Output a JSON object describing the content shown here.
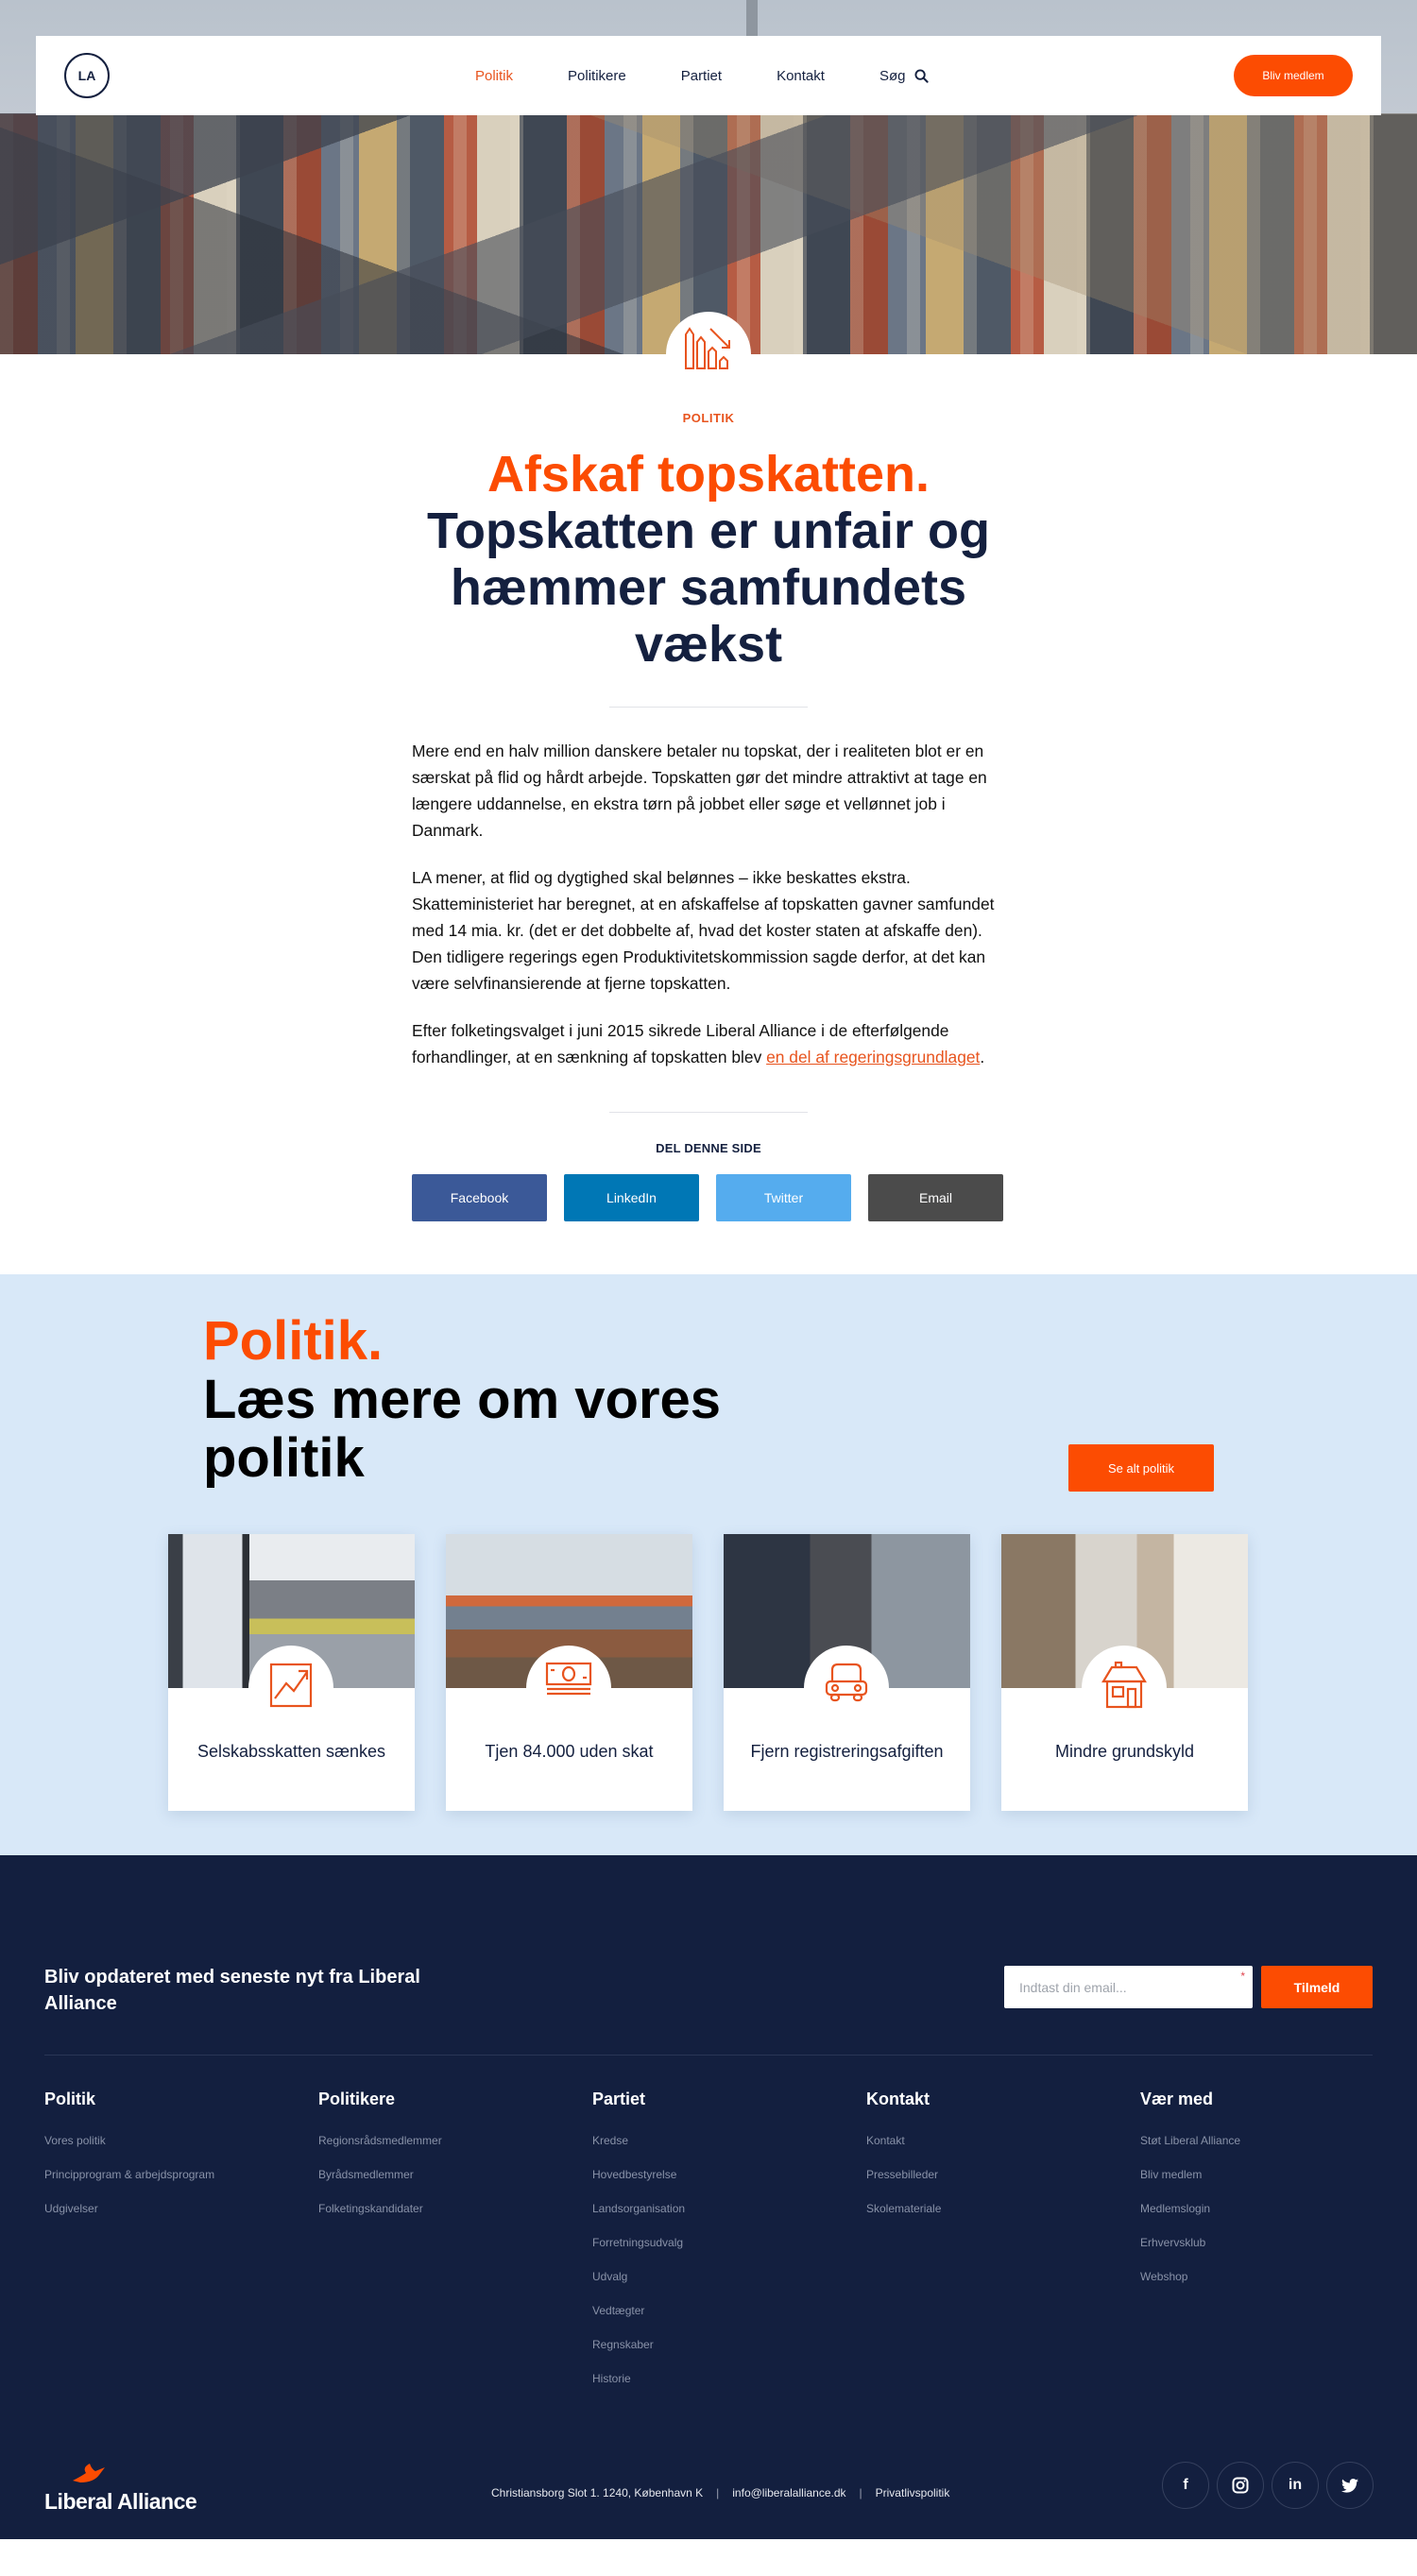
{
  "colors": {
    "accent": "#fc4c02",
    "navy": "#14203f",
    "footer_bg": "#131f3f",
    "section_bg": "#d8e8f8",
    "facebook": "#3b5998",
    "linkedin": "#0077b5",
    "twitter": "#55acee",
    "email": "#4b4b4b"
  },
  "header": {
    "logo_text": "LA",
    "nav": [
      {
        "label": "Politik",
        "active": true
      },
      {
        "label": "Politikere",
        "active": false
      },
      {
        "label": "Partiet",
        "active": false
      },
      {
        "label": "Kontakt",
        "active": false
      }
    ],
    "search_label": "Søg",
    "search_icon": "search-icon",
    "cta_label": "Bliv medlem"
  },
  "hero": {
    "badge_icon": "declining-bar-chart-icon"
  },
  "article": {
    "category": "POLITIK",
    "title_highlight": "Afskaf topskatten.",
    "title_main": "Topskatten er unfair og hæmmer samfundets vækst",
    "paragraphs": [
      "Mere end en halv million danskere betaler nu topskat, der i realiteten blot er en særskat på flid og hårdt arbejde. Topskatten gør det mindre attraktivt at tage en længere uddannelse, en ekstra tørn på jobbet eller søge et vellønnet job i Danmark.",
      "LA mener, at flid og dygtighed skal belønnes – ikke beskattes ekstra. Skatteministeriet har beregnet, at en afskaffelse af topskatten gavner samfundet med 14 mia. kr. (det er det dobbelte af, hvad det koster staten at afskaffe den). Den tidligere regerings egen Produktivitetskommission sagde derfor, at det kan være selvfinansierende at fjerne topskatten."
    ],
    "para3_before": "Efter folketingsvalget i juni 2015 sikrede Liberal Alliance i de efterfølgende forhandlinger, at en sænkning af topskatten blev ",
    "para3_link": "en del af regeringsgrundlaget",
    "para3_after": ".",
    "share": {
      "title": "DEL DENNE SIDE",
      "buttons": [
        "Facebook",
        "LinkedIn",
        "Twitter",
        "Email"
      ]
    }
  },
  "politik_section": {
    "heading_highlight": "Politik.",
    "heading_main": "Læs mere om vores politik",
    "cta_label": "Se alt politik",
    "cards": [
      {
        "title": "Selskabsskatten sænkes",
        "icon": "trending-up-icon"
      },
      {
        "title": "Tjen 84.000 uden skat",
        "icon": "banknote-icon"
      },
      {
        "title": "Fjern registreringsafgiften",
        "icon": "car-icon"
      },
      {
        "title": "Mindre grundskyld",
        "icon": "house-icon"
      }
    ]
  },
  "footer": {
    "newsletter_text": "Bliv opdateret med seneste nyt fra Liberal Alliance",
    "email_placeholder": "Indtast din email...",
    "required_mark": "*",
    "subscribe_label": "Tilmeld",
    "columns": [
      {
        "title": "Politik",
        "links": [
          "Vores politik",
          "Principprogram & arbejdsprogram",
          "Udgivelser"
        ]
      },
      {
        "title": "Politikere",
        "links": [
          "Regionsrådsmedlemmer",
          "Byrådsmedlemmer",
          "Folketingskandidater"
        ]
      },
      {
        "title": "Partiet",
        "links": [
          "Kredse",
          "Hovedbestyrelse",
          "Landsorganisation",
          "Forretningsudvalg",
          "Udvalg",
          "Vedtægter",
          "Regnskaber",
          "Historie"
        ]
      },
      {
        "title": "Kontakt",
        "links": [
          "Kontakt",
          "Pressebilleder",
          "Skolemateriale"
        ]
      },
      {
        "title": "Vær med",
        "links": [
          "Støt Liberal Alliance",
          "Bliv medlem",
          "Medlemslogin",
          "Erhvervsklub",
          "Webshop"
        ]
      }
    ],
    "logo_text": "Liberal Alliance",
    "address": "Christiansborg Slot 1. 1240, København K",
    "email": "info@liberalalliance.dk",
    "privacy": "Privatlivspolitik",
    "separator": "|",
    "socials": [
      {
        "name": "facebook",
        "glyph": "f"
      },
      {
        "name": "instagram",
        "glyph": "◎"
      },
      {
        "name": "linkedin",
        "glyph": "in"
      },
      {
        "name": "twitter",
        "glyph": "🐦"
      }
    ]
  }
}
